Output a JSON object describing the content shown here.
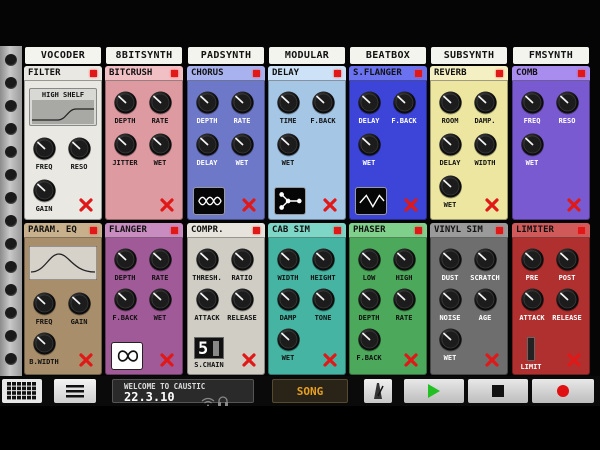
{
  "tabs": [
    "VOCODER",
    "8BITSYNTH",
    "PADSYNTH",
    "MODULAR",
    "BEATBOX",
    "SUBSYNTH",
    "FMSYNTH"
  ],
  "panels": [
    {
      "id": "filter",
      "title": "FILTER",
      "color": "#e9e8e3",
      "header": "#e9e8e3",
      "screen": {
        "label": "HIGH SHELF"
      },
      "knobs": [
        [
          "FREQ",
          "RESO"
        ],
        [
          "GAIN"
        ]
      ]
    },
    {
      "id": "bitcrush",
      "title": "BITCRUSH",
      "color": "#dd9aa0",
      "header": "#f0c0c4",
      "knobs": [
        [
          "DEPTH",
          "RATE"
        ],
        [
          "JITTER",
          "WET"
        ]
      ]
    },
    {
      "id": "chorus",
      "title": "CHORUS",
      "color": "#6e78c8",
      "header": "#a8b2ee",
      "knobs": [
        [
          "DEPTH",
          "RATE"
        ],
        [
          "DELAY",
          "WET"
        ]
      ]
    },
    {
      "id": "delay",
      "title": "DELAY",
      "color": "#a6c6e6",
      "header": "#cde2f6",
      "knobs": [
        [
          "TIME",
          "F.BACK"
        ],
        [
          "WET"
        ]
      ]
    },
    {
      "id": "sflanger",
      "title": "S.FLANGER",
      "color": "#3d44d8",
      "header": "#6a72f0",
      "knobs": [
        [
          "DELAY",
          "F.BACK"
        ],
        [
          "WET"
        ]
      ]
    },
    {
      "id": "reverb",
      "title": "REVERB",
      "color": "#ece6a0",
      "header": "#f4f0c4",
      "knobs": [
        [
          "ROOM",
          "DAMP."
        ],
        [
          "DELAY",
          "WIDTH"
        ],
        [
          "WET"
        ]
      ]
    },
    {
      "id": "comb",
      "title": "COMB",
      "color": "#7a5ad0",
      "header": "#a88cee",
      "knobs": [
        [
          "FREQ",
          "RESO"
        ],
        [
          "WET"
        ]
      ]
    },
    {
      "id": "parameq",
      "title": "PARAM. EQ",
      "color": "#a88e6a",
      "header": "#c8b08c",
      "knobs": [
        [
          "FREQ",
          "GAIN"
        ],
        [
          "B.WIDTH"
        ]
      ]
    },
    {
      "id": "flanger",
      "title": "FLANGER",
      "color": "#a05a98",
      "header": "#c88cc0",
      "knobs": [
        [
          "DEPTH",
          "RATE"
        ],
        [
          "F.BACK",
          "WET"
        ]
      ]
    },
    {
      "id": "compr",
      "title": "COMPR.",
      "color": "#cfcdc4",
      "header": "#e6e4dc",
      "knobs": [
        [
          "THRESH.",
          "RATIO"
        ],
        [
          "ATTACK",
          "RELEASE"
        ]
      ],
      "schain": {
        "label": "S.CHAIN",
        "value": "5"
      }
    },
    {
      "id": "cabsim",
      "title": "CAB SIM",
      "color": "#46b4a2",
      "header": "#7ed6c6",
      "knobs": [
        [
          "WIDTH",
          "HEIGHT"
        ],
        [
          "DAMP",
          "TONE"
        ],
        [
          "WET"
        ]
      ]
    },
    {
      "id": "phaser",
      "title": "PHASER",
      "color": "#4ca85a",
      "header": "#7ed08a",
      "knobs": [
        [
          "LOW",
          "HIGH"
        ],
        [
          "DEPTH",
          "RATE"
        ],
        [
          "F.BACK"
        ]
      ]
    },
    {
      "id": "vinylsim",
      "title": "VINYL SIM",
      "color": "#6e6e6e",
      "header": "#9a9a9a",
      "knobs": [
        [
          "DUST",
          "SCRATCH"
        ],
        [
          "NOISE",
          "AGE"
        ],
        [
          "WET"
        ]
      ]
    },
    {
      "id": "limiter",
      "title": "LIMITER",
      "color": "#b03030",
      "header": "#d05a5a",
      "knobs": [
        [
          "PRE",
          "POST"
        ],
        [
          "ATTACK",
          "RELEASE"
        ]
      ],
      "limit": {
        "label": "LIMIT"
      }
    }
  ],
  "status": {
    "line1": "WELCOME TO CAUSTIC",
    "time": "22.3.10"
  },
  "song_label": "SONG",
  "colors": {
    "accent": "#e8a020",
    "play": "#22c022",
    "record": "#e01010"
  }
}
